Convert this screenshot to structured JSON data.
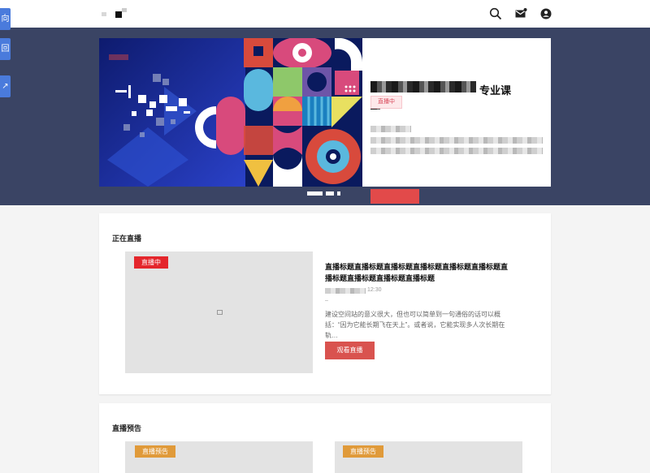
{
  "header": {
    "search_icon": "search-icon",
    "message_icon": "mail-icon",
    "account_icon": "account-icon"
  },
  "sidebar": {
    "tabs": [
      {
        "label": "向"
      },
      {
        "label": "回"
      },
      {
        "label": "↗"
      }
    ]
  },
  "banner": {
    "title_tail": "专业课",
    "title_line2": "课:",
    "status_tag": "直播中",
    "desc_tail": "…能可以概括为所必",
    "desc_line2": "经…设计…",
    "slides": 3,
    "active_slide": 1
  },
  "live_section": {
    "heading": "正在直播",
    "badge": "直播中",
    "title": "直播标题直播标题直播标题直播标题直播标题直播标题直播标题直播标题直播标题直播标题",
    "time_fragment": "12:30",
    "dash": "–",
    "description": "建设空间站的意义很大，但也可以简单到一句通俗的话可以概括：“因为它能长期飞在天上”。或者说，它能实现多人次长期在轨…",
    "watch_button": "观看直播"
  },
  "preview_section": {
    "heading": "直播预告",
    "cards": [
      {
        "badge": "直播预告"
      },
      {
        "badge": "直播预告"
      }
    ]
  },
  "colors": {
    "hero_bg": "#3a4464",
    "accent_red": "#e24a4a",
    "badge_orange": "#e09a3a",
    "tab_blue": "#4a7bdc"
  }
}
